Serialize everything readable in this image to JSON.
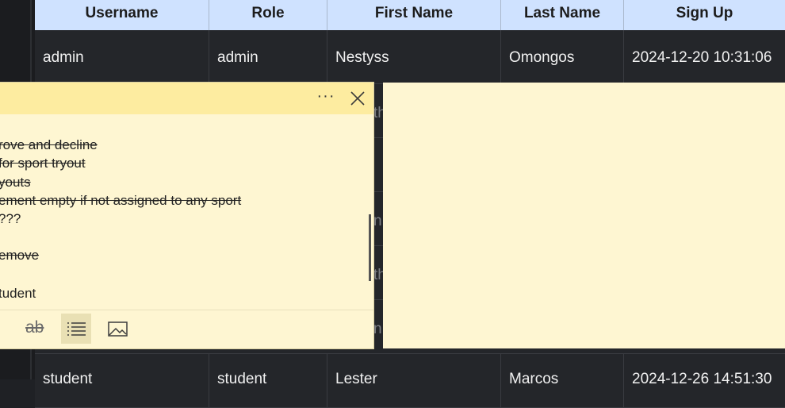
{
  "table": {
    "headers": [
      "Username",
      "Role",
      "First Name",
      "Last Name",
      "Sign Up"
    ],
    "rows": [
      [
        "admin",
        "admin",
        "Nestyss",
        "Omongos",
        "2024-12-20 10:31:06"
      ],
      [
        "student",
        "student",
        "Lester",
        "Marcos",
        "2024-12-26 14:51:30"
      ]
    ],
    "peek": [
      "th",
      "n",
      "th",
      "n"
    ]
  },
  "note": {
    "menu_label": "···",
    "lines": [
      {
        "text": "rove and decline",
        "strike": true
      },
      {
        "text": " for sport tryout",
        "strike": true
      },
      {
        "text": "youts",
        "strike": true
      },
      {
        "text": "ement empty if not assigned to any sport",
        "strike": true
      },
      {
        "text": "???",
        "strike": false
      },
      {
        "text": "emove",
        "strike": true
      },
      {
        "text": "tudent",
        "strike": false
      }
    ],
    "toolbar": {
      "strikethrough_label": "ab"
    }
  }
}
